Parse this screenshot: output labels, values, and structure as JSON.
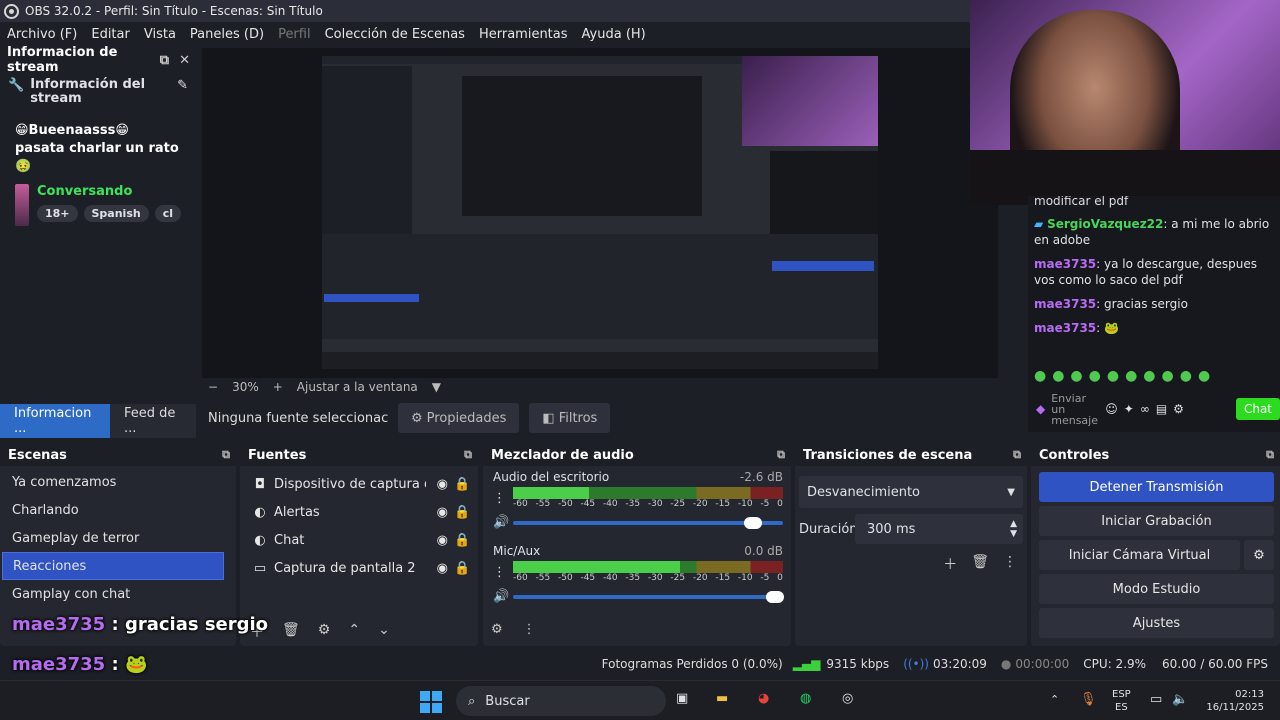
{
  "window_title": "OBS 32.0.2 - Perfil: Sin Título - Escenas: Sin Título",
  "menu": [
    "Archivo (F)",
    "Editar",
    "Vista",
    "Paneles (D)",
    "Perfil",
    "Colección de Escenas",
    "Herramientas",
    "Ayuda (H)"
  ],
  "stream_info": {
    "dock_title": "Informacion de stream",
    "heading": "Información del stream",
    "title_text": "😁Bueenaasss😁 pasata charlar un rato🤢",
    "category": "Conversando",
    "tags": [
      "18+",
      "Spanish",
      "cl"
    ]
  },
  "preview": {
    "zoom": "30%",
    "fit_label": "Ajustar a la ventana"
  },
  "dock_tabs": [
    "Informacion ...",
    "Feed de ..."
  ],
  "source_toolbar": {
    "no_source": "Ninguna fuente seleccionac",
    "properties": "Propiedades",
    "filters": "Filtros"
  },
  "scenes": {
    "title": "Escenas",
    "items": [
      "Ya comenzamos",
      "Charlando",
      "Gameplay de terror",
      "Reacciones",
      "Gamplay con chat"
    ],
    "selected": "Reacciones"
  },
  "sources": {
    "title": "Fuentes",
    "items": [
      "Dispositivo de captura de v",
      "Alertas",
      "Chat",
      "Captura de pantalla 2"
    ]
  },
  "mixer": {
    "title": "Mezclador de audio",
    "channels": [
      {
        "name": "Audio del escritorio",
        "db": "-2.6 dB",
        "level": 0.28,
        "volume": 0.9
      },
      {
        "name": "Mic/Aux",
        "db": "0.0 dB",
        "level": 0.62,
        "volume": 0.98
      }
    ],
    "scale": [
      "-60",
      "-55",
      "-50",
      "-45",
      "-40",
      "-35",
      "-30",
      "-25",
      "-20",
      "-15",
      "-10",
      "-5",
      "0"
    ]
  },
  "transitions": {
    "title": "Transiciones de escena",
    "type": "Desvanecimiento",
    "duration_label": "Duración",
    "duration": "300 ms"
  },
  "controls": {
    "title": "Controles",
    "buttons": [
      "Detener Transmisión",
      "Iniciar Grabación",
      "Iniciar Cámara Virtual",
      "Modo Estudio",
      "Ajustes"
    ]
  },
  "overlay": {
    "user": "mae3735",
    "msg1": "gracias sergio",
    "emote_line_user": "mae3735"
  },
  "status": {
    "dropped": "Fotogramas Perdidos 0 (0.0%)",
    "bitrate": "9315 kbps",
    "live_time": "03:20:09",
    "rec_time": "00:00:00",
    "cpu": "CPU: 2.9%",
    "fps": "60.00 / 60.00 FPS"
  },
  "chat": {
    "partial": "modificar el pdf",
    "messages": [
      {
        "user": "SergioVazquez22",
        "text": ": a mi me lo abrio en adobe"
      },
      {
        "user": "mae3735",
        "text": ": ya lo descargue, despues vos como lo saco del pdf"
      },
      {
        "user": "mae3735",
        "text": ": gracias sergio"
      },
      {
        "user": "mae3735",
        "text": ":"
      }
    ],
    "input_placeholder": "Enviar un mensaje",
    "send": "Chat"
  },
  "taskbar": {
    "search": "Buscar",
    "lang1": "ESP",
    "lang2": "ES",
    "time": "02:13",
    "date": "16/11/2025"
  },
  "colors": {
    "accent": "#2f53c3",
    "meter_green": "#4bcf4b",
    "chat_send": "#2cdb20",
    "username": "#b56cf0"
  }
}
